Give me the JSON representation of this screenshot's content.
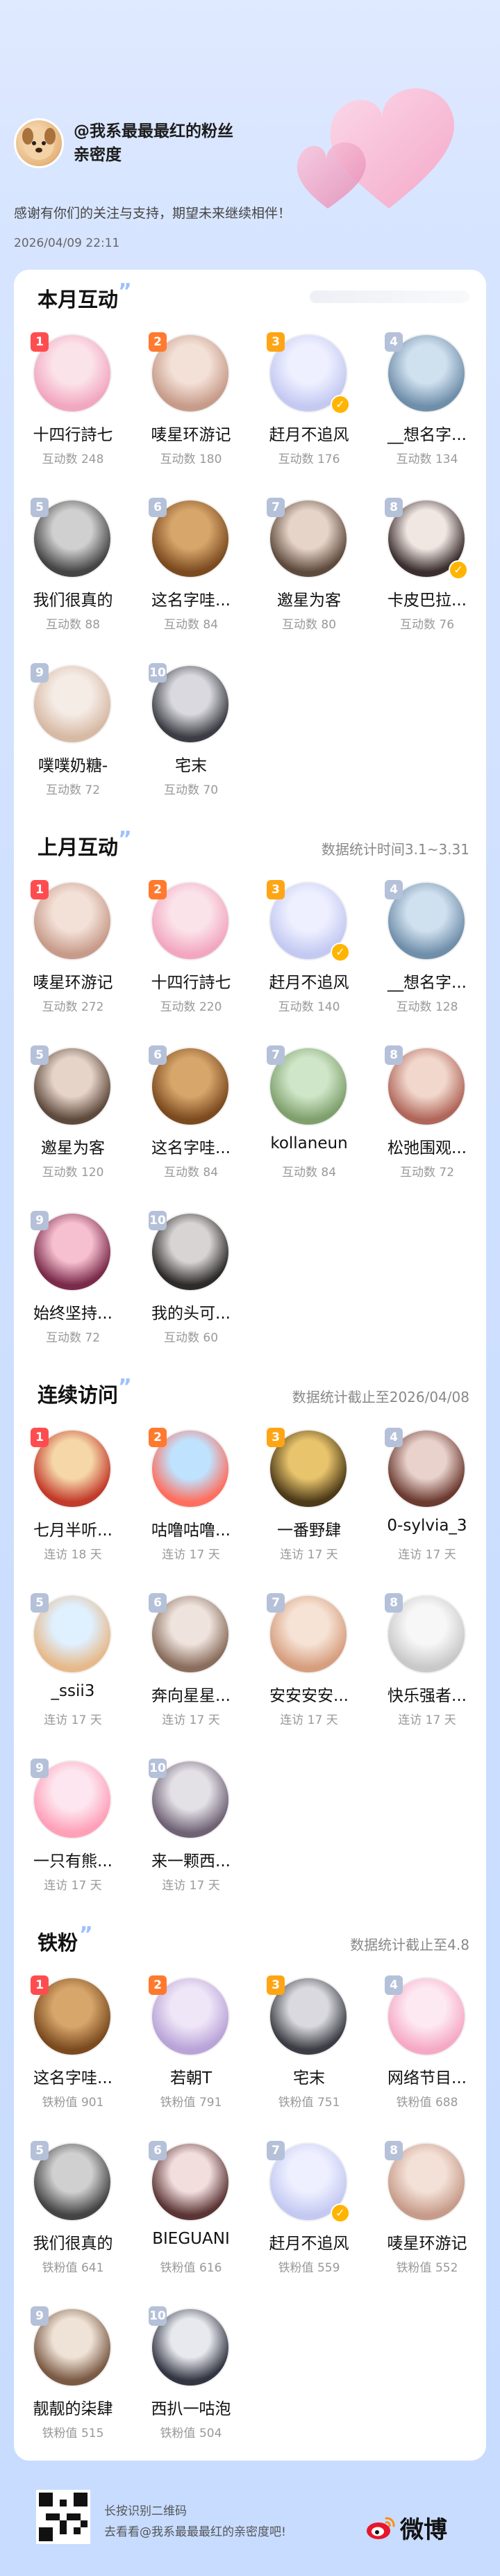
{
  "header": {
    "title": "@我系最最最红的粉丝亲密度",
    "thanks": "感谢有你们的关注与支持，期望未来继续相伴！",
    "date": "2026/04/09 22:11"
  },
  "sections": [
    {
      "title": "本月互动",
      "note": "",
      "items": [
        {
          "rank": "1",
          "name": "十四行詩七",
          "count": "互动数 248",
          "colors": [
            "#fbe3ea",
            "#f2a7c0"
          ],
          "v": false
        },
        {
          "rank": "2",
          "name": "唛星环游记",
          "count": "互动数 180",
          "colors": [
            "#f3e0d6",
            "#c79b8a"
          ],
          "v": false
        },
        {
          "rank": "3",
          "name": "赶月不追风",
          "count": "互动数 176",
          "colors": [
            "#eef0ff",
            "#c4c9f2"
          ],
          "v": true
        },
        {
          "rank": "4",
          "name": "__想名字...",
          "count": "互动数 134",
          "colors": [
            "#cfe0ee",
            "#6f8eaa"
          ],
          "v": false
        },
        {
          "rank": "5",
          "name": "我们很真的",
          "count": "互动数 88",
          "colors": [
            "#d0d0d0",
            "#444"
          ],
          "v": false
        },
        {
          "rank": "6",
          "name": "这名字哇...",
          "count": "互动数 84",
          "colors": [
            "#d7a66b",
            "#7b4a1f"
          ],
          "v": false
        },
        {
          "rank": "7",
          "name": "邀星为客",
          "count": "互动数 80",
          "colors": [
            "#e6d4c8",
            "#5e4a3d"
          ],
          "v": false
        },
        {
          "rank": "8",
          "name": "卡皮巴拉...",
          "count": "互动数 76",
          "colors": [
            "#f0e6e2",
            "#3a2e2e"
          ],
          "v": true
        },
        {
          "rank": "9",
          "name": "噗噗奶糖-",
          "count": "互动数 72",
          "colors": [
            "#f5ece6",
            "#d7b9a4"
          ],
          "v": false
        },
        {
          "rank": "10",
          "name": "宅末",
          "count": "互动数 70",
          "colors": [
            "#d9d9df",
            "#3c3c44"
          ],
          "v": false
        }
      ]
    },
    {
      "title": "上月互动",
      "note": "数据统计时间3.1~3.31",
      "items": [
        {
          "rank": "1",
          "name": "唛星环游记",
          "count": "互动数 272",
          "colors": [
            "#f3e0d6",
            "#c79b8a"
          ],
          "v": false
        },
        {
          "rank": "2",
          "name": "十四行詩七",
          "count": "互动数 220",
          "colors": [
            "#fbe3ea",
            "#f2a7c0"
          ],
          "v": false
        },
        {
          "rank": "3",
          "name": "赶月不追风",
          "count": "互动数 140",
          "colors": [
            "#eef0ff",
            "#c4c9f2"
          ],
          "v": true
        },
        {
          "rank": "4",
          "name": "__想名字...",
          "count": "互动数 128",
          "colors": [
            "#cfe0ee",
            "#6f8eaa"
          ],
          "v": false
        },
        {
          "rank": "5",
          "name": "邀星为客",
          "count": "互动数 120",
          "colors": [
            "#e6d4c8",
            "#5e4a3d"
          ],
          "v": false
        },
        {
          "rank": "6",
          "name": "这名字哇...",
          "count": "互动数 84",
          "colors": [
            "#d7a66b",
            "#7b4a1f"
          ],
          "v": false
        },
        {
          "rank": "7",
          "name": "kollaneun",
          "count": "互动数 84",
          "colors": [
            "#cfe6c8",
            "#7fa06d"
          ],
          "v": false
        },
        {
          "rank": "8",
          "name": "松弛围观...",
          "count": "互动数 72",
          "colors": [
            "#f2d7cc",
            "#b0665a"
          ],
          "v": false
        },
        {
          "rank": "9",
          "name": "始终坚持...",
          "count": "互动数 72",
          "colors": [
            "#f7c0d0",
            "#7a2a4a"
          ],
          "v": false
        },
        {
          "rank": "10",
          "name": "我的头可...",
          "count": "互动数 60",
          "colors": [
            "#d8d4d4",
            "#2d2a2a"
          ],
          "v": false
        }
      ]
    },
    {
      "title": "连续访问",
      "note": "数据统计截止至2026/04/08",
      "items": [
        {
          "rank": "1",
          "name": "七月半听...",
          "count": "连访 18 天",
          "colors": [
            "#f6d7a8",
            "#c23a2a"
          ],
          "v": false
        },
        {
          "rank": "2",
          "name": "咕噜咕噜...",
          "count": "连访 17 天",
          "colors": [
            "#bfe3ff",
            "#ff6e5e"
          ],
          "v": false
        },
        {
          "rank": "3",
          "name": "一番野肆",
          "count": "连访 17 天",
          "colors": [
            "#e8c46c",
            "#4c3a18"
          ],
          "v": false
        },
        {
          "rank": "4",
          "name": "0-sylvia_3",
          "count": "连访 17 天",
          "colors": [
            "#e9d2cc",
            "#6b3a30"
          ],
          "v": false
        },
        {
          "rank": "5",
          "name": "_ssii3",
          "count": "连访 17 天",
          "colors": [
            "#dff0ff",
            "#e7b98a"
          ],
          "v": false
        },
        {
          "rank": "6",
          "name": "奔向星星...",
          "count": "连访 17 天",
          "colors": [
            "#eee3dd",
            "#8a6d5c"
          ],
          "v": false
        },
        {
          "rank": "7",
          "name": "安安安安...",
          "count": "连访 17 天",
          "colors": [
            "#f6e3d5",
            "#d79e7e"
          ],
          "v": false
        },
        {
          "rank": "8",
          "name": "快乐强者...",
          "count": "连访 17 天",
          "colors": [
            "#f7f7f7",
            "#c9c9c9"
          ],
          "v": false
        },
        {
          "rank": "9",
          "name": "一只有熊...",
          "count": "连访 17 天",
          "colors": [
            "#fde6ef",
            "#ff9fb8"
          ],
          "v": false
        },
        {
          "rank": "10",
          "name": "来一颗西...",
          "count": "连访 17 天",
          "colors": [
            "#e3e0e6",
            "#6f6275"
          ],
          "v": false
        }
      ]
    },
    {
      "title": "铁粉",
      "note": "数据统计截止至4.8",
      "items": [
        {
          "rank": "1",
          "name": "这名字哇...",
          "count": "铁粉值 901",
          "colors": [
            "#d7a66b",
            "#7b4a1f"
          ],
          "v": false
        },
        {
          "rank": "2",
          "name": "若朝T",
          "count": "铁粉值 791",
          "colors": [
            "#efe6f7",
            "#b9a3d8"
          ],
          "v": false
        },
        {
          "rank": "3",
          "name": "宅末",
          "count": "铁粉值 751",
          "colors": [
            "#d9d9df",
            "#3c3c44"
          ],
          "v": false
        },
        {
          "rank": "4",
          "name": "网络节目...",
          "count": "铁粉值 688",
          "colors": [
            "#fde9f1",
            "#f6a9c5"
          ],
          "v": false
        },
        {
          "rank": "5",
          "name": "我们很真的",
          "count": "铁粉值 641",
          "colors": [
            "#d0d0d0",
            "#444"
          ],
          "v": false
        },
        {
          "rank": "6",
          "name": "BIEGUANI",
          "count": "铁粉值 616",
          "colors": [
            "#f3dede",
            "#5b3434"
          ],
          "v": false
        },
        {
          "rank": "7",
          "name": "赶月不追风",
          "count": "铁粉值 559",
          "colors": [
            "#eef0ff",
            "#c4c9f2"
          ],
          "v": true
        },
        {
          "rank": "8",
          "name": "唛星环游记",
          "count": "铁粉值 552",
          "colors": [
            "#f3e0d6",
            "#c79b8a"
          ],
          "v": false
        },
        {
          "rank": "9",
          "name": "靓靓的柒肆",
          "count": "铁粉值 515",
          "colors": [
            "#efe2d6",
            "#7a5a44"
          ],
          "v": false
        },
        {
          "rank": "10",
          "name": "西扒一咕泡",
          "count": "铁粉值 504",
          "colors": [
            "#e7e9ef",
            "#323642"
          ],
          "v": false
        }
      ]
    }
  ],
  "footer": {
    "line1": "长按识别二维码",
    "line2": "去看看@我系最最最红的亲密度吧!",
    "brand": "微博"
  },
  "colors": {
    "rank1": "#ff4d4f",
    "rank2": "#ff7a2e",
    "rank3": "#ffa515",
    "rankN": "#b5c1d9",
    "vbadge": "#ffb400"
  }
}
